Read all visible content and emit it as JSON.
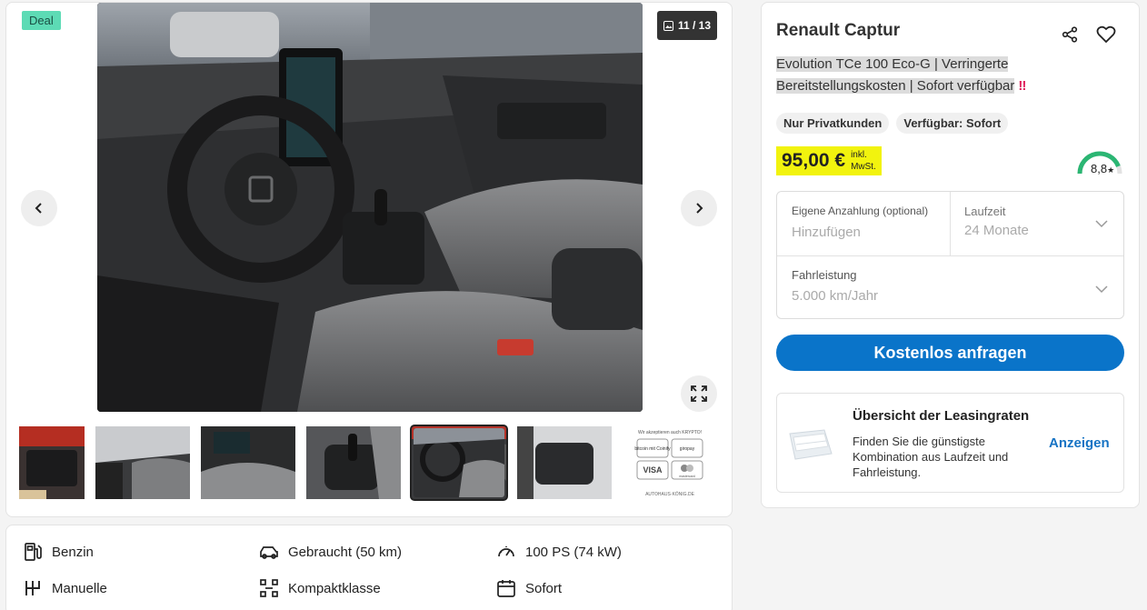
{
  "gallery": {
    "deal_badge": "Deal",
    "counter": "11 / 13",
    "thumbnails": [
      "Kofferraum",
      "Innenraum",
      "Cockpit",
      "Schaltung",
      "Lenkrad",
      "Rücksitz",
      "Zahlungsarten"
    ],
    "payment_logo": {
      "header": "Wir akzeptieren auch KRYPTO!",
      "items": [
        "bitcoin mit Coinify",
        "giropay",
        "VISA",
        "mastercard"
      ],
      "footer": "AUTOHAUS·KÖNIG.DE"
    }
  },
  "specs": [
    {
      "icon": "fuel-icon",
      "label": "Benzin"
    },
    {
      "icon": "car-icon",
      "label": "Gebraucht (50 km)"
    },
    {
      "icon": "speedometer-icon",
      "label": "100 PS (74 kW)"
    },
    {
      "icon": "gearshift-icon",
      "label": "Manuelle"
    },
    {
      "icon": "class-icon",
      "label": "Kompaktklasse"
    },
    {
      "icon": "calendar-icon",
      "label": "Sofort"
    }
  ],
  "listing": {
    "title": "Renault Captur",
    "subtitle_line1": "Evolution TCe 100 Eco-G | Verringerte",
    "subtitle_line2": "Bereitstellungskosten | Sofort verfügbar",
    "subtitle_mark": "‼",
    "chips": [
      "Nur Privatkunden",
      "Verfügbar: Sofort"
    ],
    "price": "95,00 €",
    "price_note_1": "inkl.",
    "price_note_2": "MwSt.",
    "rating": "8,8",
    "rating_star": "★",
    "rating_value": 8.8,
    "rating_max": 10
  },
  "form": {
    "downpayment_label": "Eigene Anzahlung (optional)",
    "downpayment_placeholder": "Hinzufügen",
    "term_label": "Laufzeit",
    "term_value": "24 Monate",
    "mileage_label": "Fahrleistung",
    "mileage_value": "5.000 km/Jahr"
  },
  "cta": "Kostenlos anfragen",
  "lease": {
    "title": "Übersicht der Leasingraten",
    "text": "Finden Sie die günstigste Kombination aus Laufzeit und Fahrleistung.",
    "link": "Anzeigen"
  },
  "colors": {
    "accent": "#0a74c9",
    "deal": "#5ddbb5",
    "price_highlight": "#f2f30e",
    "rating_green": "#2bb673"
  }
}
